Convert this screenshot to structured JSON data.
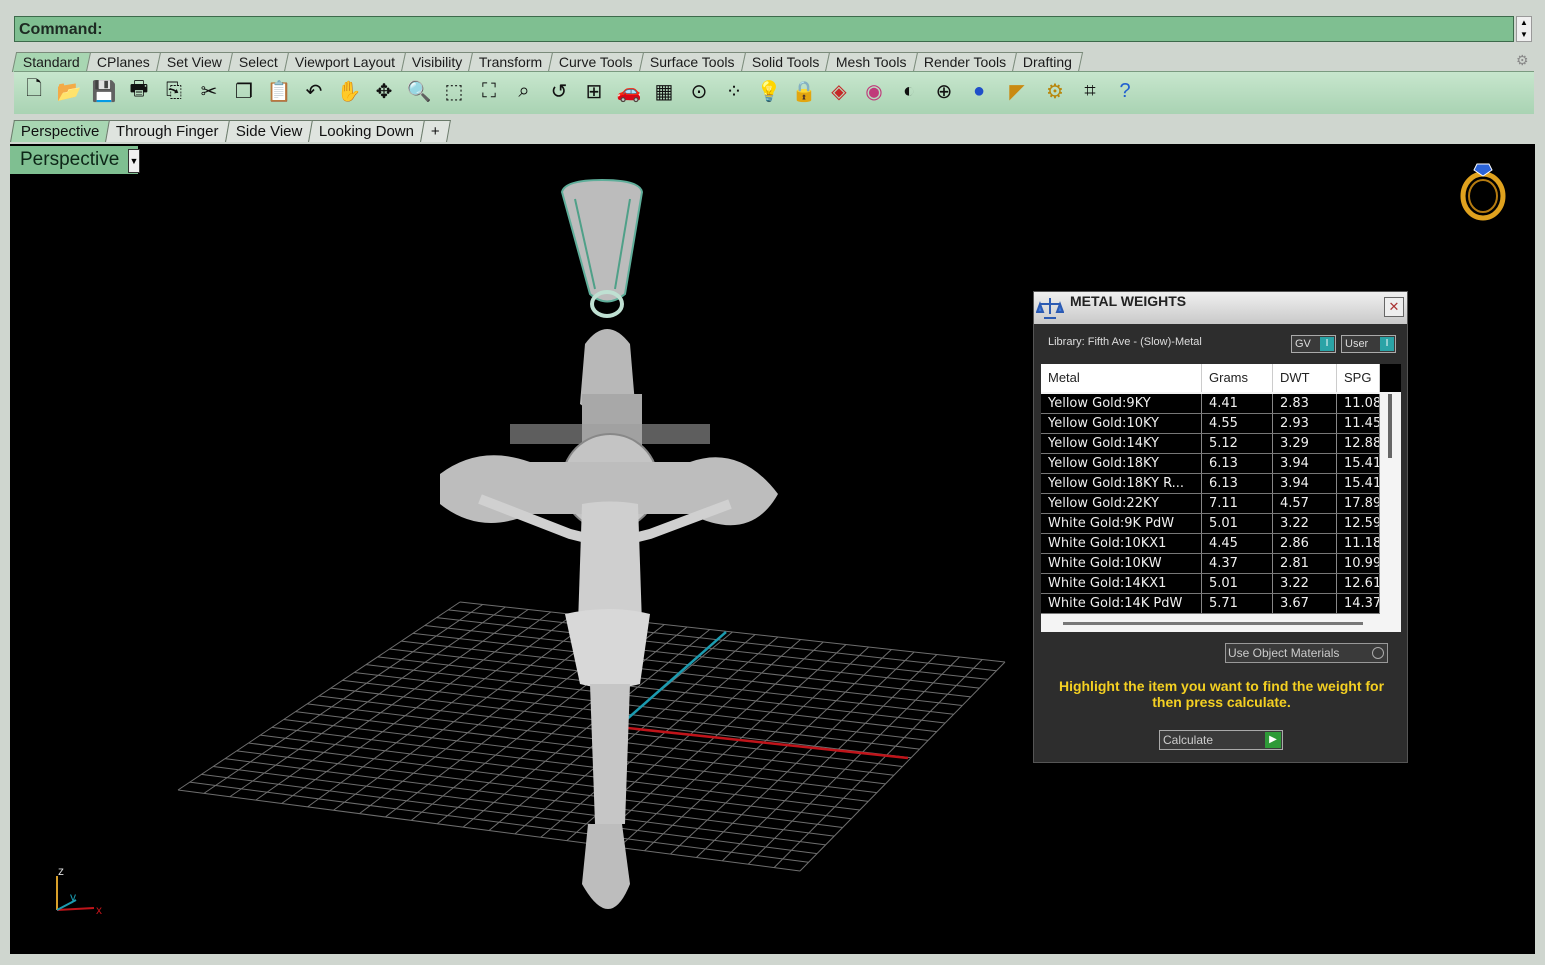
{
  "command": {
    "label": "Command:"
  },
  "toolbar_tabs": [
    "Standard",
    "CPlanes",
    "Set View",
    "Select",
    "Viewport Layout",
    "Visibility",
    "Transform",
    "Curve Tools",
    "Surface Tools",
    "Solid Tools",
    "Mesh Tools",
    "Render Tools",
    "Drafting"
  ],
  "toolbar_icons": [
    "new-file-icon",
    "open-folder-icon",
    "save-icon",
    "print-icon",
    "import-icon",
    "cut-icon",
    "copy-icon",
    "paste-icon",
    "undo-icon",
    "pan-hand-icon",
    "rotate-view-icon",
    "zoom-icon",
    "zoom-window-icon",
    "zoom-extents-icon",
    "zoom-selected-icon",
    "undo-view-icon",
    "four-viewports-icon",
    "car-icon",
    "grid-plane-icon",
    "cplane-icon",
    "points-icon",
    "lightbulb-icon",
    "lock-icon",
    "layer-icon",
    "color-wheel-icon",
    "wireframe-sphere-icon",
    "shaded-sphere-icon",
    "rendered-sphere-icon",
    "dimension-icon",
    "settings-gear-icon",
    "snap-icon",
    "help-icon"
  ],
  "viewport_tabs": [
    "Perspective",
    "Through Finger",
    "Side View",
    "Looking Down"
  ],
  "viewport": {
    "label": "Perspective"
  },
  "axes": {
    "x": "x",
    "y": "y",
    "z": "z"
  },
  "metal_weights": {
    "title": "METAL WEIGHTS",
    "library": "Library: Fifth Ave - (Slow)-Metal",
    "gv_label": "GV",
    "user_label": "User",
    "columns": [
      "Metal",
      "Grams",
      "DWT",
      "SPG"
    ],
    "rows": [
      [
        "Yellow Gold:9KY",
        "4.41",
        "2.83",
        "11.08"
      ],
      [
        "Yellow Gold:10KY",
        "4.55",
        "2.93",
        "11.45"
      ],
      [
        "Yellow Gold:14KY",
        "5.12",
        "3.29",
        "12.88"
      ],
      [
        "Yellow Gold:18KY",
        "6.13",
        "3.94",
        "15.41"
      ],
      [
        "Yellow Gold:18KY R...",
        "6.13",
        "3.94",
        "15.41"
      ],
      [
        "Yellow Gold:22KY",
        "7.11",
        "4.57",
        "17.89"
      ],
      [
        "White Gold:9K PdW",
        "5.01",
        "3.22",
        "12.59"
      ],
      [
        "White Gold:10KX1",
        "4.45",
        "2.86",
        "11.18"
      ],
      [
        "White Gold:10KW",
        "4.37",
        "2.81",
        "10.99"
      ],
      [
        "White Gold:14KX1",
        "5.01",
        "3.22",
        "12.61"
      ],
      [
        "White Gold:14K PdW",
        "5.71",
        "3.67",
        "14.37"
      ]
    ],
    "use_object_materials": "Use Object Materials",
    "hint": "Highlight the item you want to find the weight for then press calculate.",
    "calculate_label": "Calculate"
  },
  "colors": {
    "accent_green": "#7fbf91",
    "hint_yellow": "#f4d022",
    "axis_red": "#c0141a",
    "axis_cyan": "#1b9bb0"
  }
}
